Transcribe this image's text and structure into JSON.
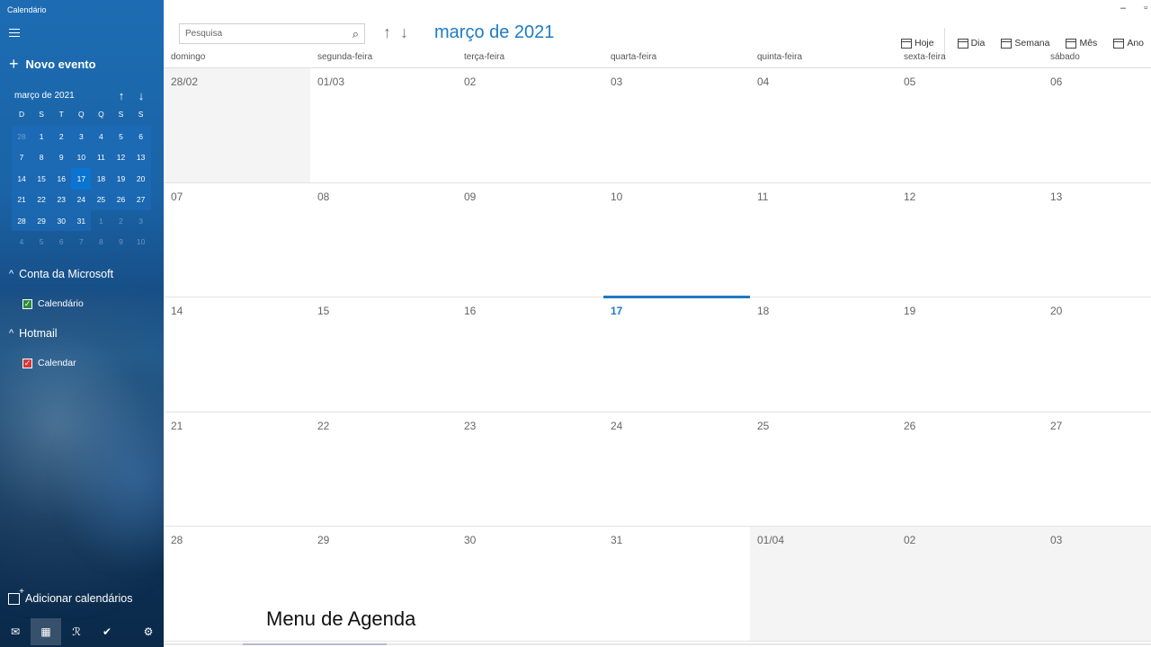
{
  "app": {
    "title": "Calendário"
  },
  "sidebar": {
    "new_event_label": "Novo evento",
    "mini_calendar": {
      "title": "março de 2021",
      "weekdays": [
        "D",
        "S",
        "T",
        "Q",
        "Q",
        "S",
        "S"
      ],
      "weeks": [
        [
          "28",
          "1",
          "2",
          "3",
          "4",
          "5",
          "6"
        ],
        [
          "7",
          "8",
          "9",
          "10",
          "11",
          "12",
          "13"
        ],
        [
          "14",
          "15",
          "16",
          "17",
          "18",
          "19",
          "20"
        ],
        [
          "21",
          "22",
          "23",
          "24",
          "25",
          "26",
          "27"
        ],
        [
          "28",
          "29",
          "30",
          "31",
          "1",
          "2",
          "3"
        ],
        [
          "4",
          "5",
          "6",
          "7",
          "8",
          "9",
          "10"
        ]
      ],
      "today": "17"
    },
    "groups": [
      {
        "title": "Conta da Microsoft",
        "calendars": [
          {
            "name": "Calendário",
            "color": "#2c8a3e"
          }
        ]
      },
      {
        "title": "Hotmail",
        "calendars": [
          {
            "name": "Calendar",
            "color": "#d43838"
          }
        ]
      }
    ],
    "add_calendars_label": "Adicionar calendários",
    "bottom_icons": [
      "mail-icon",
      "calendar-icon",
      "people-icon",
      "todo-icon",
      "settings-icon"
    ]
  },
  "toolbar": {
    "search_placeholder": "Pesquisa",
    "month_title": "março de 2021",
    "views": [
      "Hoje",
      "Dia",
      "Semana",
      "Mês",
      "Ano"
    ]
  },
  "month_view": {
    "weekdays": [
      "domingo",
      "segunda-feira",
      "terça-feira",
      "quarta-feira",
      "quinta-feira",
      "sexta-feira",
      "sábado"
    ],
    "weeks": [
      [
        "28/02",
        "01/03",
        "02",
        "03",
        "04",
        "05",
        "06"
      ],
      [
        "07",
        "08",
        "09",
        "10",
        "11",
        "12",
        "13"
      ],
      [
        "14",
        "15",
        "16",
        "17",
        "18",
        "19",
        "20"
      ],
      [
        "21",
        "22",
        "23",
        "24",
        "25",
        "26",
        "27"
      ],
      [
        "28",
        "29",
        "30",
        "31",
        "01/04",
        "02",
        "03"
      ]
    ],
    "today": "17"
  },
  "caption": "Menu de Agenda",
  "colors": {
    "accent": "#1e7bc4",
    "sidebar_top": "#1d6cb3",
    "sidebar_bottom": "#0b2a4a"
  }
}
